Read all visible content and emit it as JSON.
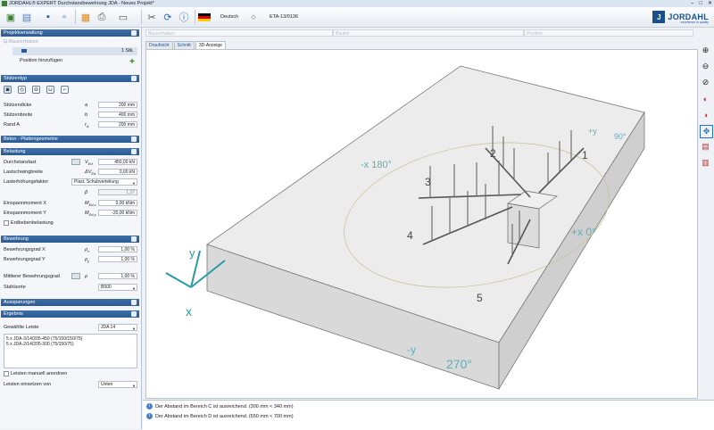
{
  "window": {
    "title": "JORDAHL® EXPERT Durchstanzbewehrung JDA - Neues Projekt*"
  },
  "toolbar": {
    "language": "Deutsch",
    "approval": "ETA-13/0136"
  },
  "brand": {
    "name": "JORDAHL",
    "tagline": "excellence in quality"
  },
  "fields": {
    "f1": "Bauvorhaben",
    "f2": "Bauteil",
    "f3": "Position"
  },
  "project": {
    "header": "Projektverwaltung",
    "root": "Bauvorhaben",
    "count": "1 Stk.",
    "add_position": "Position hinzufügen"
  },
  "stuetzentyp": {
    "header": "Stützentyp"
  },
  "dimensions": {
    "rows": [
      {
        "label": "Stützendicke",
        "sym": "a",
        "value": "200 mm"
      },
      {
        "label": "Stützenbreite",
        "sym": "b",
        "value": "400 mm"
      },
      {
        "label": "Rand A",
        "sym": "r",
        "sub": "A",
        "value": "200 mm"
      }
    ]
  },
  "beton": {
    "header": "Beton - Plattengeometrie"
  },
  "belastung": {
    "header": "Belastung",
    "durchstanzlast": {
      "label": "Durchstanzlast",
      "sym": "V",
      "sub": "Ed",
      "value": "450,00 kN"
    },
    "lastschwing": {
      "label": "Lastschwingbreite",
      "sym": "ΔV",
      "sub": "Ed",
      "value": "0,00 kN"
    },
    "lasterhoehung": {
      "label": "Lasterhöhungsfaktor",
      "value": "Plast. Schubverteilung"
    },
    "beta": {
      "sym": "β",
      "value": "1,37"
    },
    "mx": {
      "label": "Einspannmoment X",
      "sym": "M",
      "sub": "Ed,x",
      "value": "0,00 kNm"
    },
    "my": {
      "label": "Einspannmoment Y",
      "sym": "M",
      "sub": "Ed,y",
      "value": "-20,00 kNm"
    },
    "erdbeben": "Erdbebenbelastung"
  },
  "bewehrung": {
    "header": "Bewehrung",
    "gx": {
      "label": "Bewehrungsgrad X",
      "sym": "ρ",
      "sub": "x",
      "value": "1,00 %"
    },
    "gy": {
      "label": "Bewehrungsgrad Y",
      "sym": "ρ",
      "sub": "y",
      "value": "1,00 %"
    },
    "gm": {
      "label": "Mittlerer Bewehrungsgrad",
      "sym": "ρ",
      "value": "1,00 %"
    },
    "stahl": {
      "label": "Stahlsorte",
      "value": "B500"
    }
  },
  "aussparungen": {
    "header": "Aussparungen"
  },
  "ergebnis": {
    "header": "Ergebnis",
    "leiste_label": "Gewählte Leiste",
    "leiste_value": "JDA 14",
    "line1": "5 x JDA-3/14/205-450 (75/150/150/75)",
    "line2": "5 x JDA-2/14/205-300 (75/150/75)",
    "manuell": "Leisten manuell anordnen",
    "einsetzen_label": "Leisten einsetzen von",
    "einsetzen_value": "Unten"
  },
  "tabs": {
    "t1": "Draufsicht",
    "t2": "Schnitt",
    "t3": "3D-Anzeige"
  },
  "view3d": {
    "labels": {
      "neg180": "-x 180°",
      "posy90": "+y 90°",
      "posx0": "+x 0°",
      "negy270": "-y 270°",
      "axis_y": "y",
      "axis_x": "x",
      "n1": "1",
      "n2": "2",
      "n3": "3",
      "n4": "4",
      "n5": "5",
      "deg90": "90°",
      "deg270": "270°",
      "plus_y": "+y",
      "minus_y": "-y"
    }
  },
  "messages": [
    "Der Abstand im Bereich C ist ausreichend. (300 mm < 340 mm)",
    "Der Abstand im Bereich D ist ausreichend. (650 mm < 700 mm)"
  ]
}
